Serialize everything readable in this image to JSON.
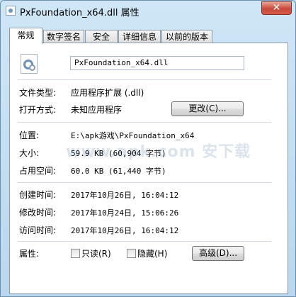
{
  "window": {
    "title": "PxFoundation_x64.dll 属性",
    "close_label": "✕"
  },
  "tabs": [
    {
      "label": "常规",
      "active": true
    },
    {
      "label": "数字签名"
    },
    {
      "label": "安全"
    },
    {
      "label": "详细信息"
    },
    {
      "label": "以前的版本"
    }
  ],
  "general": {
    "file_name": "PxFoundation_x64.dll",
    "file_type_label": "文件类型:",
    "file_type_value": "应用程序扩展 (.dll)",
    "opens_with_label": "打开方式:",
    "opens_with_value": "未知应用程序",
    "change_button": "更改(C)...",
    "location_label": "位置:",
    "location_value": "E:\\apk游戏\\PxFoundation_x64",
    "size_label": "大小:",
    "size_value": "59.9 KB (60,904 字节)",
    "size_on_disk_label": "占用空间:",
    "size_on_disk_value": "60.0 KB (61,440 字节)",
    "created_label": "创建时间:",
    "created_value": "2017年10月26日, 16:04:12",
    "modified_label": "修改时间:",
    "modified_value": "2017年10月24日, 15:06:26",
    "accessed_label": "访问时间:",
    "accessed_value": "2017年10月26日, 16:04:12",
    "attributes_label": "属性:",
    "readonly_label": "只读(R)",
    "hidden_label": "隐藏(H)",
    "advanced_button": "高级(D)..."
  },
  "watermark": "www.apk.com 安下载",
  "colors": {
    "accent": "#c7493a",
    "frame": "#b9d7ee"
  },
  "icons": [
    "app-icon",
    "close-icon",
    "dll-file-icon"
  ]
}
